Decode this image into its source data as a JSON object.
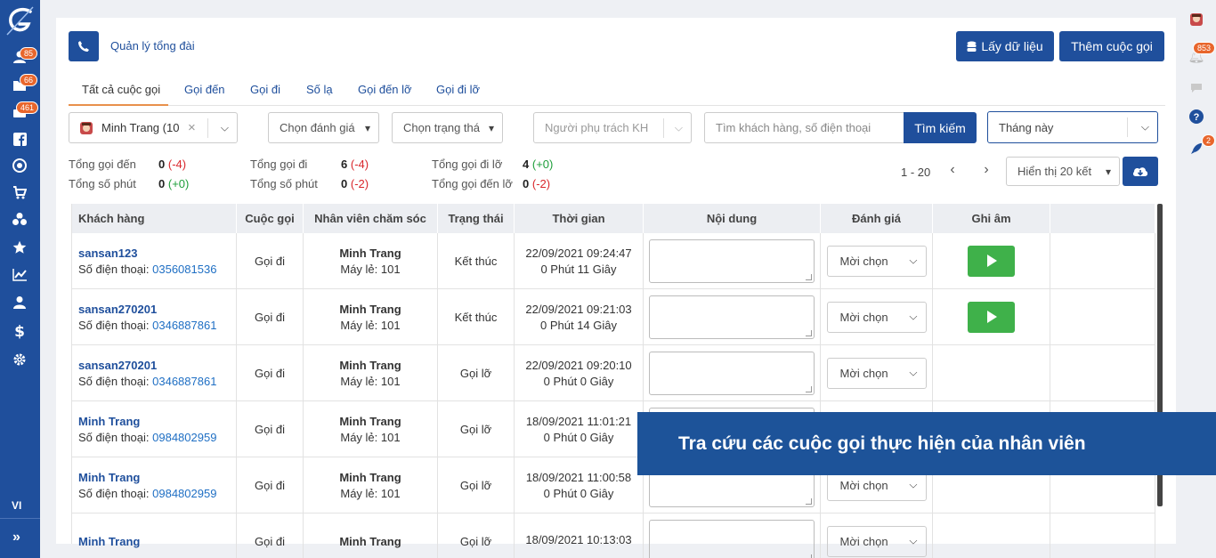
{
  "sidebar": {
    "badges": [
      "85",
      "66",
      "461"
    ],
    "icons": [
      "user-icon",
      "folder-icon",
      "briefcase-icon",
      "facebook-icon",
      "target-icon",
      "cart-icon",
      "biohazard-icon",
      "star-icon",
      "chart-icon",
      "users-icon",
      "dollar-icon",
      "gear-icon"
    ],
    "lang": "VI",
    "expand_glyph": "»"
  },
  "rightbar": {
    "notif_badge": "853",
    "rocket_badge": "2"
  },
  "header": {
    "title": "Quản lý tổng đài",
    "fetch_label": "Lấy dữ liệu",
    "add_call_label": "Thêm cuộc gọi"
  },
  "tabs": [
    "Tất cả cuộc gọi",
    "Gọi đến",
    "Gọi đi",
    "Số lạ",
    "Gọi đến lỡ",
    "Gọi đi lỡ"
  ],
  "filters": {
    "staff_value": "Minh Trang (10",
    "rating_value": "Chọn đánh giá",
    "status_value": "Chọn trạng thá",
    "owner_placeholder": "Người phụ trách KH",
    "search_placeholder": "Tìm khách hàng, số điện thoại",
    "search_button": "Tìm kiếm",
    "period_value": "Tháng này"
  },
  "stats": [
    {
      "label": "Tổng gọi đến",
      "value": "0",
      "delta": "(-4)",
      "tone": "neg"
    },
    {
      "label": "Tổng số phút",
      "value": "0",
      "delta": "(+0)",
      "tone": "pos"
    },
    {
      "label": "Tổng gọi đi",
      "value": "6",
      "delta": "(-4)",
      "tone": "neg"
    },
    {
      "label": "Tổng số phút",
      "value": "0",
      "delta": "(-2)",
      "tone": "neg"
    },
    {
      "label": "Tổng gọi đi lỡ",
      "value": "4",
      "delta": "(+0)",
      "tone": "pos"
    },
    {
      "label": "Tổng gọi đến lỡ",
      "value": "0",
      "delta": "(-2)",
      "tone": "neg"
    }
  ],
  "pagination": {
    "range": "1 - 20",
    "page_size": "Hiển thị 20 kết"
  },
  "table": {
    "headers": [
      "Khách hàng",
      "Cuộc gọi",
      "Nhân viên chăm sóc",
      "Trạng thái",
      "Thời gian",
      "Nội dung",
      "Đánh giá",
      "Ghi âm"
    ],
    "phone_label": "Số điện thoại:",
    "ext_label": "Máy lẻ:",
    "rating_default": "Mời chọn",
    "rows": [
      {
        "customer": "sansan123",
        "phone": "0356081536",
        "type": "Gọi đi",
        "staff": "Minh Trang",
        "ext": "101",
        "status": "Kết thúc",
        "datetime": "22/09/2021 09:24:47",
        "duration": "0 Phút 11 Giây",
        "has_recording": true
      },
      {
        "customer": "sansan270201",
        "phone": "0346887861",
        "type": "Gọi đi",
        "staff": "Minh Trang",
        "ext": "101",
        "status": "Kết thúc",
        "datetime": "22/09/2021 09:21:03",
        "duration": "0 Phút 14 Giây",
        "has_recording": true
      },
      {
        "customer": "sansan270201",
        "phone": "0346887861",
        "type": "Gọi đi",
        "staff": "Minh Trang",
        "ext": "101",
        "status": "Gọi lỡ",
        "datetime": "22/09/2021 09:20:10",
        "duration": "0 Phút 0 Giây",
        "has_recording": false
      },
      {
        "customer": "Minh Trang",
        "phone": "0984802959",
        "type": "Gọi đi",
        "staff": "Minh Trang",
        "ext": "101",
        "status": "Gọi lỡ",
        "datetime": "18/09/2021 11:01:21",
        "duration": "0 Phút 0 Giây",
        "has_recording": false
      },
      {
        "customer": "Minh Trang",
        "phone": "0984802959",
        "type": "Gọi đi",
        "staff": "Minh Trang",
        "ext": "101",
        "status": "Gọi lỡ",
        "datetime": "18/09/2021 11:00:58",
        "duration": "0 Phút 0 Giây",
        "has_recording": false
      },
      {
        "customer": "Minh Trang",
        "phone": "",
        "type": "Gọi đi",
        "staff": "Minh Trang",
        "ext": "",
        "status": "Gọi lỡ",
        "datetime": "18/09/2021 10:13:03",
        "duration": "",
        "has_recording": false
      }
    ]
  },
  "banner": {
    "text": "Tra cứu các cuộc gọi thực hiện của nhân viên"
  },
  "colors": {
    "brand": "#1f4f9c",
    "accent_tab": "#e8904c",
    "play": "#3fb14a",
    "badge": "#e8662c"
  }
}
